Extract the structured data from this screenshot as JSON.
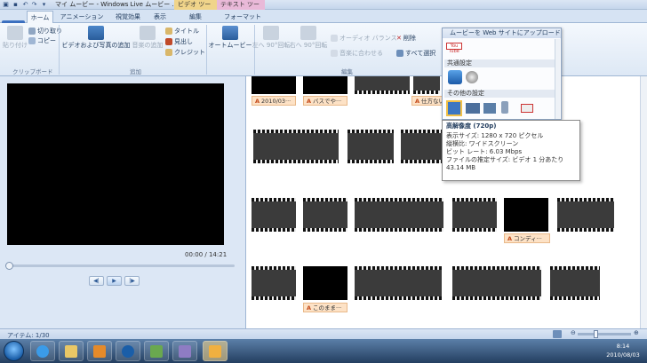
{
  "window": {
    "title": "マイ ムービー - Windows Live ムービー ..."
  },
  "context_tabs": {
    "video_tools": "ビデオ ツール",
    "text_tools": "テキスト ツール"
  },
  "tabs": {
    "file": "",
    "home": "ホーム",
    "animation": "アニメーション",
    "visual_effects": "視覚効果",
    "view": "表示",
    "edit": "編集",
    "format": "フォーマット"
  },
  "ribbon": {
    "clipboard": {
      "paste": "貼り付け",
      "cut": "切り取り",
      "copy": "コピー",
      "group": "クリップボード"
    },
    "add": {
      "add_video": "ビデオおよび写真の追加",
      "add_music": "音楽の追加",
      "title": "タイトル",
      "caption": "見出し",
      "credit": "クレジット",
      "group": "追加"
    },
    "automovie": "オートムービー",
    "edit": {
      "rotate_left": "左へ 90°回転",
      "rotate_right": "右へ 90°回転",
      "audio_balance": "オーディオ バランス",
      "fit_to_music": "音楽に合わせる",
      "delete": "削除",
      "select_all": "すべて選択",
      "group": "編集"
    }
  },
  "preview": {
    "timecode": "00:00 / 14:21",
    "prev": "◀|",
    "play": "▶",
    "next": "|▶"
  },
  "storyboard": {
    "captions": [
      "2010/03···",
      "バスでや···",
      "仕方ない···",
      "コンディ···",
      "このまま···"
    ]
  },
  "upload_popup": {
    "header": "ムービーを Web サイトにアップロード",
    "youtube": "You Tube",
    "common": "共通設定",
    "other": "その他の設定"
  },
  "tooltip": {
    "title": "高解像度 (720p)",
    "lines": [
      "表示サイズ: 1280 x 720 ピクセル",
      "縦横比: ワイドスクリーン",
      "ビット レート: 6.03 Mbps",
      "ファイルの推定サイズ: ビデオ 1 分あたり",
      "43.14 MB"
    ]
  },
  "status": {
    "items": "アイテム: 1/30"
  },
  "clock": {
    "time": "8:14",
    "date": "2010/08/03"
  },
  "colors": {
    "accent": "#2d5a96",
    "caption_bg": "#fde2c6"
  }
}
